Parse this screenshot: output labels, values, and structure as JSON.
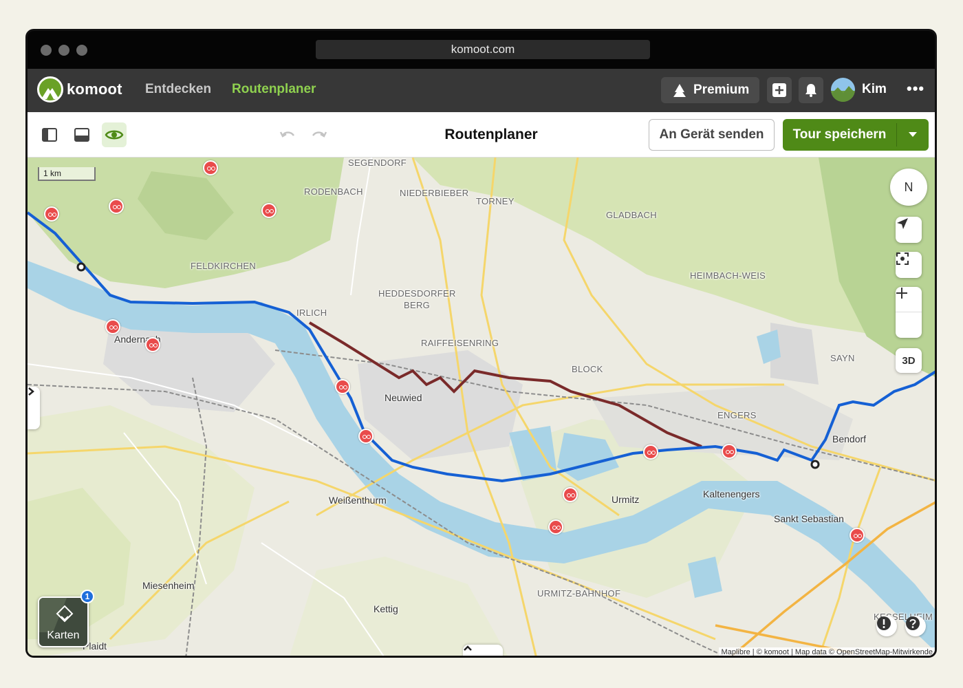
{
  "browser": {
    "url": "komoot.com"
  },
  "header": {
    "brand": "komoot",
    "nav": [
      "Entdecken",
      "Routenplaner"
    ],
    "premium_label": "Premium",
    "user_name": "Kim",
    "more": "•••"
  },
  "toolbar": {
    "title": "Routenplaner",
    "send_label": "An Gerät senden",
    "save_label": "Tour speichern"
  },
  "map": {
    "scale": "1 km",
    "view_3d": "3D",
    "compass": "N",
    "layers_label": "Karten",
    "layers_badge": "1",
    "attribution": "Maplibre | © komoot | Map data © OpenStreetMap-Mitwirkende",
    "places": [
      "SEGENDORF",
      "RODENBACH",
      "NIEDERBIEBER",
      "TORNEY",
      "GLADBACH",
      "FELDKIRCHEN",
      "HEDDESDORFER",
      "BERG",
      "IRLICH",
      "HEIMBACH-WEIS",
      "Andernach",
      "RAIFFEISENRING",
      "BLOCK",
      "SAYN",
      "Neuwied",
      "ENGERS",
      "Bendorf",
      "Weißenthurm",
      "Urmitz",
      "Kaltenengers",
      "Sankt Sebastian",
      "URMITZ-BAHNHOF",
      "Miesenheim",
      "Kettig",
      "Plaidt",
      "KESSELHEIM"
    ],
    "colors": {
      "route": "#1560d4",
      "river": "#a9d3e6",
      "accent": "#4f8a17"
    }
  }
}
